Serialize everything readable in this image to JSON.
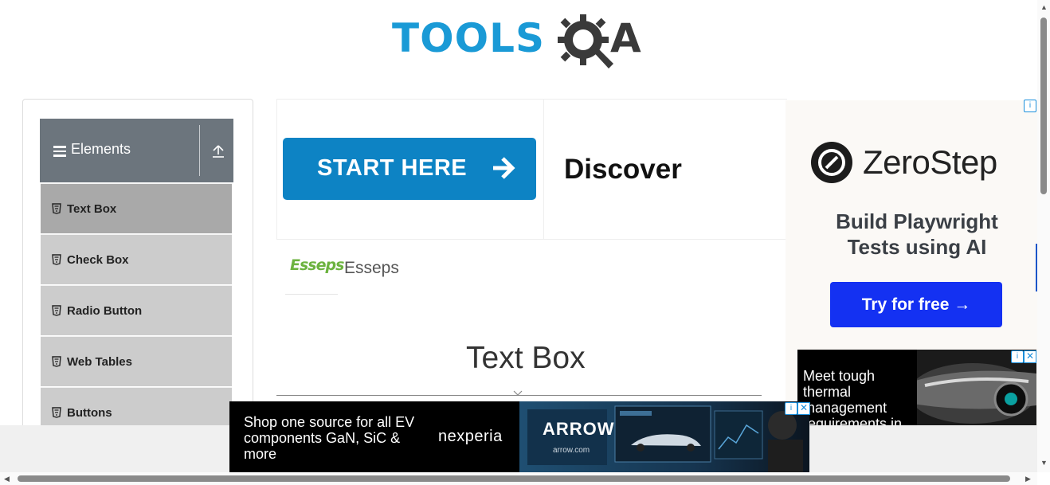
{
  "logo": {
    "text_left": "TOOLS",
    "text_right": "A",
    "brand_blue": "#1a9ad6",
    "brand_dark": "#3a3a3a"
  },
  "sidebar": {
    "group_title": "Elements",
    "items": [
      {
        "label": "Text Box",
        "active": true
      },
      {
        "label": "Check Box",
        "active": false
      },
      {
        "label": "Radio Button",
        "active": false
      },
      {
        "label": "Web Tables",
        "active": false
      },
      {
        "label": "Buttons",
        "active": false
      }
    ]
  },
  "banner": {
    "start_label": "START HERE",
    "discover": "Discover",
    "button_color": "#0d83c4"
  },
  "sponsor": {
    "logo_text": "Esseps",
    "name": "Esseps"
  },
  "main": {
    "page_title": "Text Box"
  },
  "ad_right": {
    "brand": "ZeroStep",
    "tagline": "Build Playwright Tests using AI",
    "cta": "Try for free →",
    "cta_color": "#1431f2"
  },
  "ad_small": {
    "text": "Meet tough thermal management requirements in"
  },
  "ad_bottom": {
    "text": "Shop one source for all EV components GaN, SiC & more",
    "brand": "nexperia",
    "partner": "ARROW",
    "partner_url": "arrow.com"
  },
  "icons": [
    "gear-q-icon",
    "hamburger-icon",
    "collapse-icon",
    "html5-icon",
    "arrow-right-icon",
    "ad-info-icon",
    "ad-close-icon",
    "chevron-down-icon"
  ]
}
